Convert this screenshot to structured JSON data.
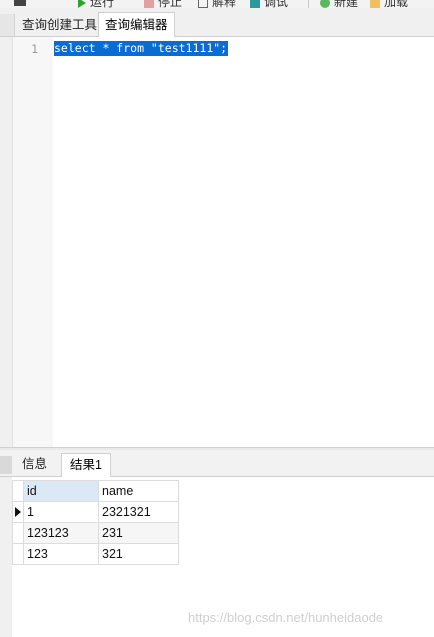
{
  "toolbar": {
    "items": [
      {
        "label": "运行",
        "icon": "play-icon"
      },
      {
        "label": "停止",
        "icon": "stop-icon"
      },
      {
        "label": "解释",
        "icon": "explain-icon"
      },
      {
        "label": "调试",
        "icon": "debug-icon"
      },
      {
        "label": "新建",
        "icon": "new-icon"
      },
      {
        "label": "加载",
        "icon": "folder-icon"
      }
    ]
  },
  "editor_tabs": [
    {
      "label": "查询创建工具",
      "active": false
    },
    {
      "label": "查询编辑器",
      "active": true
    }
  ],
  "editor": {
    "line_number": "1",
    "code": "select * from \"test1111\";"
  },
  "result_tabs": [
    {
      "label": "信息",
      "active": false
    },
    {
      "label": "结果1",
      "active": true
    }
  ],
  "grid": {
    "columns": [
      "id",
      "name"
    ],
    "rows": [
      [
        "1",
        "2321321"
      ],
      [
        "123123",
        "231"
      ],
      [
        "123",
        "321"
      ]
    ]
  },
  "watermark": "https://blog.csdn.net/hunheidaode",
  "colors": {
    "selection": "#0a6cd2",
    "header_selected": "#dbe9f7",
    "watermark": "#cfcfcf"
  }
}
